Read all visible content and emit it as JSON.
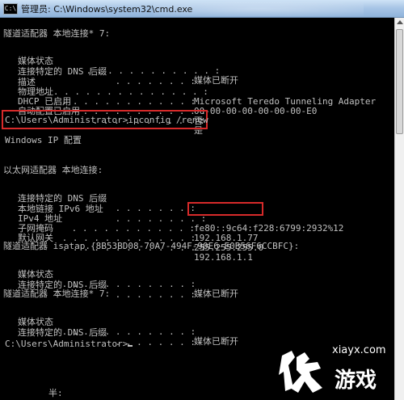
{
  "window": {
    "icon_label": "C:\\",
    "title": "管理员: C:\\Windows\\system32\\cmd.exe"
  },
  "console": {
    "teredo_header": "隧道适配器 本地连接* 7:",
    "teredo_fields": [
      {
        "label": "媒体状态",
        "dots": " . . . . . . . . . . . . :",
        "value": "媒体已断开"
      },
      {
        "label": "连接特定的 DNS 后缀",
        "dots": " . . . . . . . :",
        "value": ""
      },
      {
        "label": "描述",
        "dots": " . . . . . . . . . . . . . . . :",
        "value": "Microsoft Teredo Tunneling Adapter"
      },
      {
        "label": "物理地址",
        "dots": " . . . . . . . . . . . . :",
        "value": "00-00-00-00-00-00-00-E0"
      },
      {
        "label": "DHCP 已启用",
        "dots": " . . . . . . . . . . . :",
        "value": "否"
      },
      {
        "label": "自动配置已启用",
        "dots": " . . . . . . . . . . :",
        "value": "是"
      }
    ],
    "command_line": "C:\\Users\\Administrator>ipconfig /renew",
    "windows_ip": "Windows IP 配置",
    "ethernet_header": "以太网适配器 本地连接:",
    "ethernet_fields": [
      {
        "label": "连接特定的 DNS 后缀",
        "dots": " . . . . . . . :",
        "value": ""
      },
      {
        "label": "本地链接 IPv6 地址",
        "dots": " . . . . . . . . :",
        "value": "fe80::9c64:f228:6799:2932%12"
      },
      {
        "label": "IPv4 地址",
        "dots": " . . . . . . . . . . . :",
        "value": "192.168.1.77"
      },
      {
        "label": "子网掩码",
        "dots": " . . . . . . . . . . . . :",
        "value": "255.255.255.0"
      },
      {
        "label": "默认网关",
        "dots": " . . . . . . . . . . . . . :",
        "value": "192.168.1.1"
      }
    ],
    "isatap_header": "隧道适配器 isatap.{8B53BD08-70A7-494F-90E6-E0B56F6CCBFC}:",
    "isatap_fields": [
      {
        "label": "媒体状态",
        "dots": " . . . . . . . . . . . . :",
        "value": "媒体已断开"
      },
      {
        "label": "连接特定的 DNS 后缀",
        "dots": " . . . . . . . :",
        "value": ""
      }
    ],
    "teredo2_header": "隧道适配器 本地连接* 7:",
    "teredo2_fields": [
      {
        "label": "媒体状态",
        "dots": " . . . . . . . . . . . . :",
        "value": "媒体已断开"
      },
      {
        "label": "连接特定的 DNS 后缀",
        "dots": " . . . . . . . :",
        "value": ""
      }
    ],
    "prompt": "C:\\Users\\Administrator>",
    "bottom_partial": "半:"
  },
  "watermark": {
    "domain": "xiayx.com",
    "game_text": "游戏"
  },
  "colors": {
    "console_bg": "#000000",
    "console_text": "#c0c0c0",
    "highlight": "#d72a2a"
  }
}
